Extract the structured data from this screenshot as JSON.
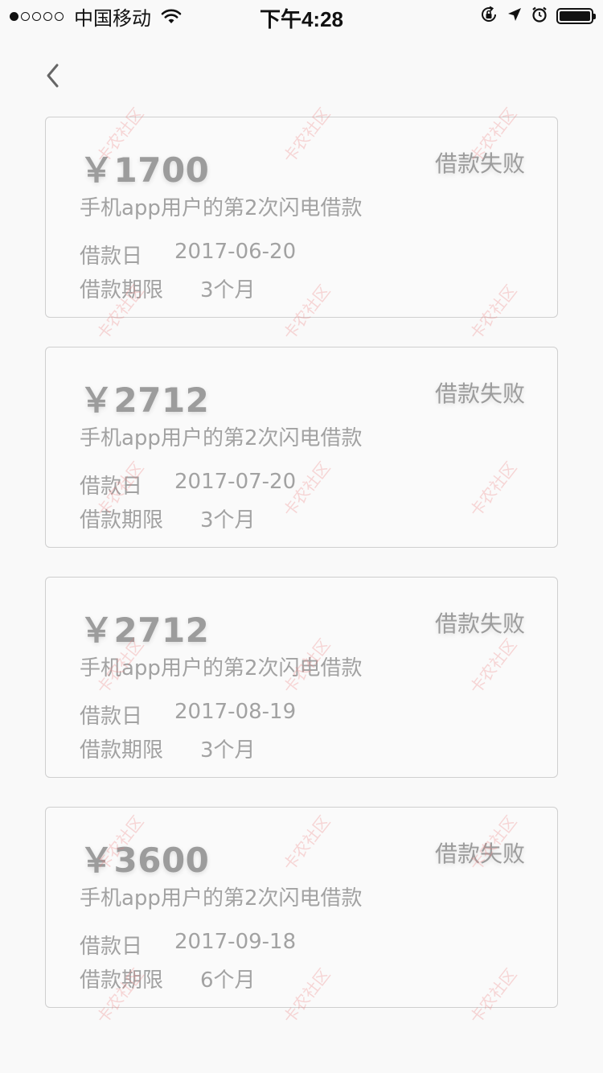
{
  "status_bar": {
    "carrier": "中国移动",
    "time": "下午4:28",
    "icons": [
      "signal-icon",
      "wifi-icon",
      "rotation-lock-icon",
      "location-icon",
      "alarm-icon",
      "battery-icon"
    ]
  },
  "nav": {
    "back_icon": "chevron-left-icon"
  },
  "currency_symbol": "￥",
  "loans": [
    {
      "amount": "￥1700",
      "status": "借款失败",
      "description": "手机app用户的第2次闪电借款",
      "date_label": "借款日",
      "date_value": "2017-06-20",
      "term_label": "借款期限",
      "term_value": "3个月"
    },
    {
      "amount": "￥2712",
      "status": "借款失败",
      "description": "手机app用户的第2次闪电借款",
      "date_label": "借款日",
      "date_value": "2017-07-20",
      "term_label": "借款期限",
      "term_value": "3个月"
    },
    {
      "amount": "￥2712",
      "status": "借款失败",
      "description": "手机app用户的第2次闪电借款",
      "date_label": "借款日",
      "date_value": "2017-08-19",
      "term_label": "借款期限",
      "term_value": "3个月"
    },
    {
      "amount": "￥3600",
      "status": "借款失败",
      "description": "手机app用户的第2次闪电借款",
      "date_label": "借款日",
      "date_value": "2017-09-18",
      "term_label": "借款期限",
      "term_value": "6个月"
    }
  ],
  "watermark_text": "卡农社区",
  "colors": {
    "background": "#f9f9f9",
    "card_border": "#cfcfcf",
    "text_muted": "#9a9a9a",
    "watermark": "#ee7878"
  }
}
